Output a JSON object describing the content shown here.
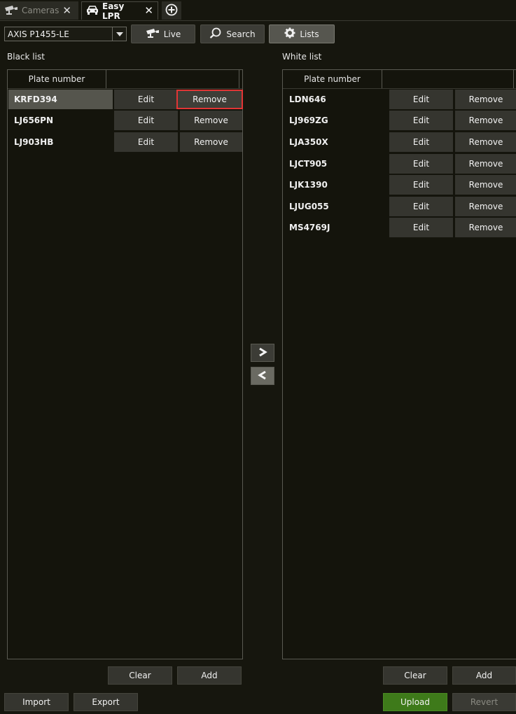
{
  "tabs": [
    {
      "label": "Cameras",
      "icon": "camera-icon"
    },
    {
      "label": "Easy LPR",
      "icon": "car-icon"
    }
  ],
  "toolbar": {
    "camera_select": "AXIS P1455-LE",
    "live_label": "Live",
    "search_label": "Search",
    "lists_label": "Lists"
  },
  "black_list": {
    "title": "Black list",
    "column_header": "Plate number",
    "rows": [
      {
        "plate": "KRFD394",
        "edit": "Edit",
        "remove": "Remove"
      },
      {
        "plate": "LJ656PN",
        "edit": "Edit",
        "remove": "Remove"
      },
      {
        "plate": "LJ903HB",
        "edit": "Edit",
        "remove": "Remove"
      }
    ],
    "clear_label": "Clear",
    "add_label": "Add"
  },
  "white_list": {
    "title": "White list",
    "column_header": "Plate number",
    "rows": [
      {
        "plate": "LDN646",
        "edit": "Edit",
        "remove": "Remove"
      },
      {
        "plate": "LJ969ZG",
        "edit": "Edit",
        "remove": "Remove"
      },
      {
        "plate": "LJA350X",
        "edit": "Edit",
        "remove": "Remove"
      },
      {
        "plate": "LJCT905",
        "edit": "Edit",
        "remove": "Remove"
      },
      {
        "plate": "LJK1390",
        "edit": "Edit",
        "remove": "Remove"
      },
      {
        "plate": "LJUG055",
        "edit": "Edit",
        "remove": "Remove"
      },
      {
        "plate": "MS4769J",
        "edit": "Edit",
        "remove": "Remove"
      }
    ],
    "clear_label": "Clear",
    "add_label": "Add"
  },
  "footer": {
    "import_label": "Import",
    "export_label": "Export",
    "upload_label": "Upload",
    "revert_label": "Revert"
  },
  "colors": {
    "background": "#16160e",
    "highlight": "#e23535",
    "upload": "#3e7a1a"
  }
}
